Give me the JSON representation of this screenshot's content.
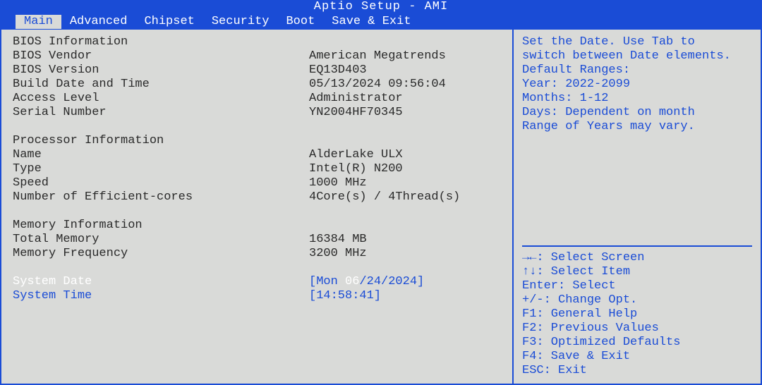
{
  "title": "Aptio Setup - AMI",
  "menu": {
    "items": [
      "Main",
      "Advanced",
      "Chipset",
      "Security",
      "Boot",
      "Save & Exit"
    ],
    "active_index": 0
  },
  "main": {
    "bios_info_header": "BIOS Information",
    "bios_vendor_label": "BIOS Vendor",
    "bios_vendor_value": "American Megatrends",
    "bios_version_label": "BIOS Version",
    "bios_version_value": "EQ13D403",
    "build_date_label": "Build Date and Time",
    "build_date_value": "05/13/2024 09:56:04",
    "access_level_label": "Access Level",
    "access_level_value": "Administrator",
    "serial_label": "Serial Number",
    "serial_value": "YN2004HF70345",
    "proc_info_header": "Processor Information",
    "proc_name_label": "Name",
    "proc_name_value": "AlderLake ULX",
    "proc_type_label": "Type",
    "proc_type_value": "Intel(R) N200",
    "proc_speed_label": "Speed",
    "proc_speed_value": "1000 MHz",
    "proc_ecores_label": "Number of Efficient-cores",
    "proc_ecores_value": "4Core(s) / 4Thread(s)",
    "mem_info_header": "Memory Information",
    "mem_total_label": "Total Memory",
    "mem_total_value": "16384 MB",
    "mem_freq_label": "Memory Frequency",
    "mem_freq_value": " 3200 MHz",
    "sys_date_label": "System Date",
    "sys_date_prefix": "[Mon ",
    "sys_date_active": "06",
    "sys_date_suffix": "/24/2024]",
    "sys_time_label": "System Time",
    "sys_time_value": "[14:58:41]"
  },
  "help": {
    "desc_lines": [
      "Set the Date. Use Tab to",
      "switch between Date elements.",
      "Default Ranges:",
      "Year: 2022-2099",
      "Months: 1-12",
      "Days: Dependent on month",
      "Range of Years may vary."
    ],
    "keys": [
      "→←: Select Screen",
      "↑↓: Select Item",
      "Enter: Select",
      "+/-: Change Opt.",
      "F1: General Help",
      "F2: Previous Values",
      "F3: Optimized Defaults",
      "F4: Save & Exit",
      "ESC: Exit"
    ]
  }
}
